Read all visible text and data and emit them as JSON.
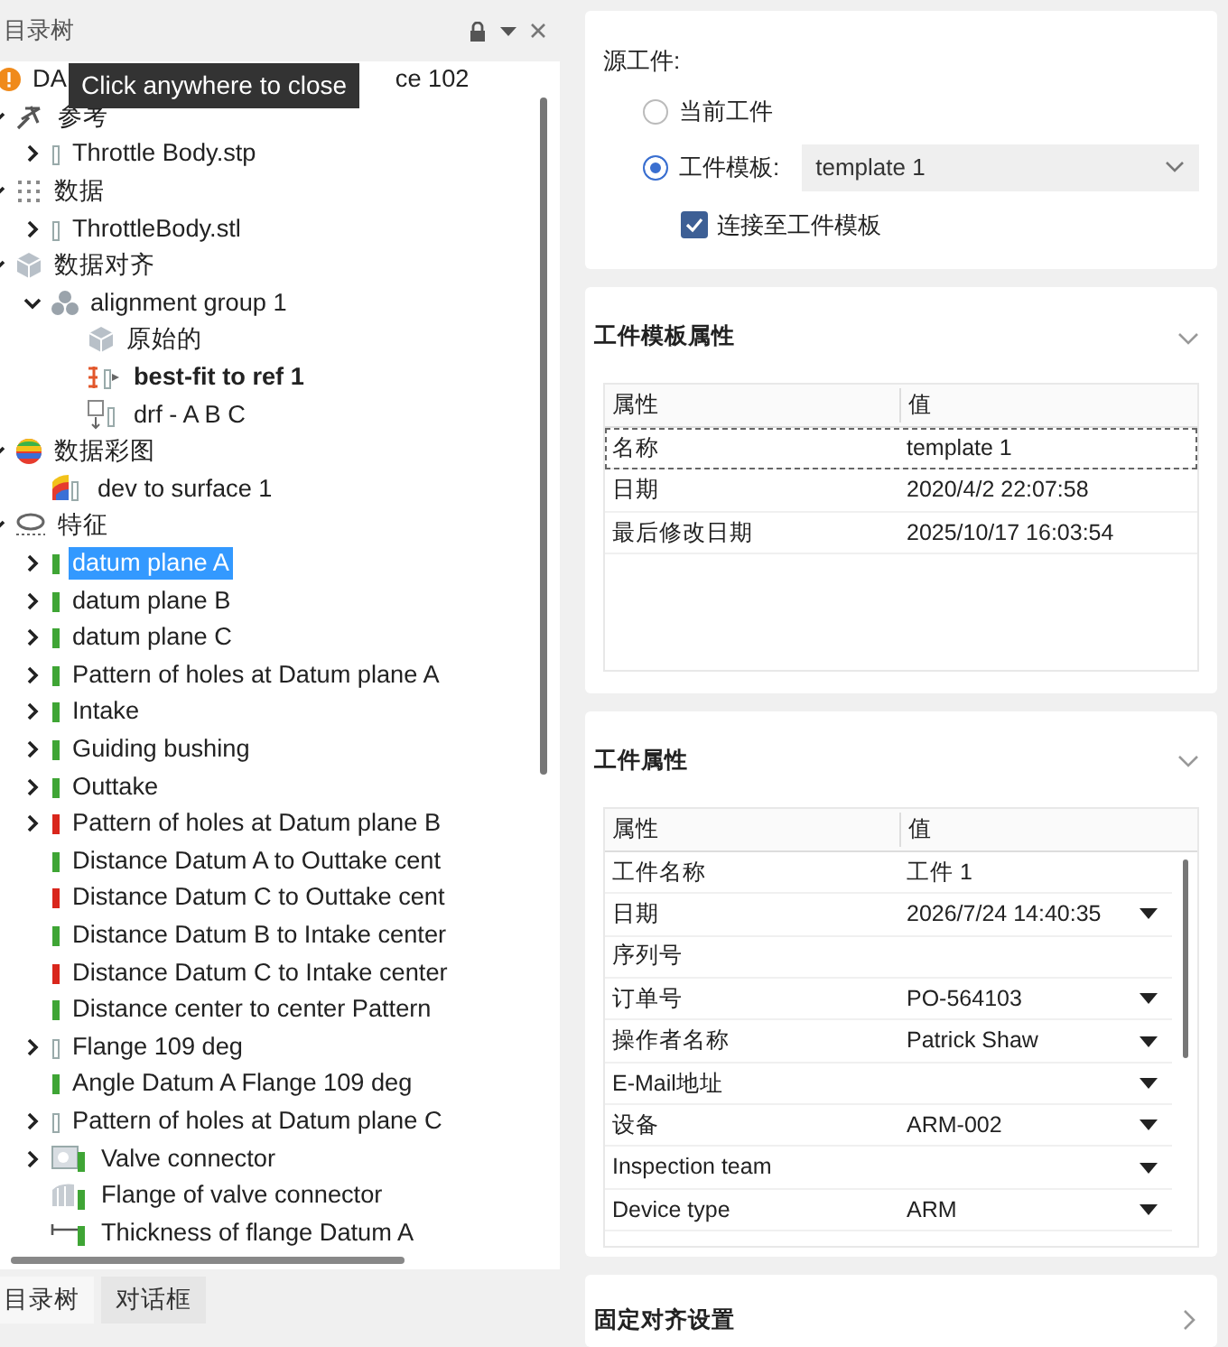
{
  "tree_panel": {
    "title": "目录树",
    "tooltip": "Click anywhere to close",
    "items": [
      {
        "kind": "root",
        "label_parts": [
          "DA",
          "ce 102"
        ],
        "selected": false
      },
      {
        "kind": "reference",
        "label": "参考",
        "expanded": true,
        "selected": false,
        "children": [
          {
            "kind": "blank",
            "label": "Throttle Body.stp",
            "expanded": false,
            "selected": false
          }
        ]
      },
      {
        "kind": "data",
        "label": "数据",
        "expanded": true,
        "selected": false,
        "children": [
          {
            "kind": "mesh",
            "label": "ThrottleBody.stl",
            "expanded": false,
            "selected": false
          }
        ]
      },
      {
        "kind": "alignment",
        "label": "数据对齐",
        "expanded": true,
        "selected": false,
        "children": [
          {
            "kind": "group",
            "label": "alignment group 1",
            "expanded": true,
            "selected": false,
            "children": [
              {
                "kind": "cube",
                "label": "原始的",
                "active": false,
                "selected": false
              },
              {
                "kind": "bestfit",
                "label": "best-fit to ref 1",
                "active": true,
                "selected": false
              },
              {
                "kind": "drf",
                "label": "drf - A B C",
                "active": false,
                "selected": false
              }
            ]
          }
        ]
      },
      {
        "kind": "colormap",
        "label": "数据彩图",
        "expanded": true,
        "selected": false,
        "children": [
          {
            "kind": "devmap",
            "label": "dev to surface 1",
            "selected": false
          }
        ]
      },
      {
        "kind": "features",
        "label": "特征",
        "expanded": true,
        "selected": false,
        "children": [
          {
            "kind": "feature",
            "label": "datum plane A",
            "color": "#3fa535",
            "expanded": false,
            "selected": true
          },
          {
            "kind": "feature",
            "label": "datum plane B",
            "color": "#3fa535",
            "expanded": false,
            "selected": false
          },
          {
            "kind": "feature",
            "label": "datum plane C",
            "color": "#3fa535",
            "expanded": false,
            "selected": false
          },
          {
            "kind": "feature",
            "label": "Pattern of holes at Datum plane A",
            "color": "#3fa535",
            "expanded": false,
            "selected": false
          },
          {
            "kind": "feature",
            "label": "Intake",
            "color": "#3fa535",
            "expanded": false,
            "selected": false
          },
          {
            "kind": "feature",
            "label": "Guiding bushing",
            "color": "#3fa535",
            "expanded": false,
            "selected": false
          },
          {
            "kind": "feature",
            "label": "Outtake",
            "color": "#3fa535",
            "expanded": false,
            "selected": false
          },
          {
            "kind": "feature",
            "label": "Pattern of holes at Datum plane B",
            "color": "#d9261c",
            "expanded": false,
            "selected": false
          },
          {
            "kind": "feature",
            "label": "Distance Datum A to Outtake cent",
            "color": "#3fa535",
            "selected": false
          },
          {
            "kind": "feature",
            "label": "Distance Datum C to Outtake cent",
            "color": "#d9261c",
            "selected": false
          },
          {
            "kind": "feature",
            "label": "Distance Datum B to Intake center",
            "color": "#3fa535",
            "selected": false
          },
          {
            "kind": "feature",
            "label": "Distance Datum C to Intake center",
            "color": "#d9261c",
            "selected": false
          },
          {
            "kind": "feature",
            "label": "Distance center to center Pattern",
            "color": "#3fa535",
            "selected": false
          },
          {
            "kind": "feature-empty",
            "label": "Flange 109 deg",
            "expanded": false,
            "selected": false
          },
          {
            "kind": "feature",
            "label": "Angle Datum A Flange 109 deg",
            "color": "#3fa535",
            "selected": false
          },
          {
            "kind": "feature-empty",
            "label": "Pattern of holes at Datum plane C",
            "expanded": false,
            "selected": false
          },
          {
            "kind": "valve",
            "label": "Valve connector",
            "color": "#3fa535",
            "expanded": false,
            "selected": false
          },
          {
            "kind": "flange",
            "label": "Flange of valve connector",
            "color": "#3fa535",
            "selected": false
          },
          {
            "kind": "thickness",
            "label": "Thickness of flange Datum A",
            "color": "#3fa535",
            "selected": false
          }
        ]
      }
    ],
    "bottom_tabs": [
      {
        "label": "目录树",
        "selected": true
      },
      {
        "label": "对话框",
        "selected": false
      }
    ]
  },
  "source_card": {
    "label": "源工件:",
    "options": [
      {
        "label": "当前工件",
        "selected": false
      },
      {
        "label": "工件模板:",
        "selected": true,
        "value": "template 1"
      }
    ],
    "link_checkbox": {
      "label": "连接至工件模板",
      "checked": true
    }
  },
  "template_card": {
    "title": "工件模板属性",
    "expanded": true,
    "columns": [
      "属性",
      "值"
    ],
    "rows": [
      {
        "name": "名称",
        "value": "template 1",
        "selected": true
      },
      {
        "name": "日期",
        "value": "2020/4/2 22:07:58",
        "selected": false
      },
      {
        "name": "最后修改日期",
        "value": "2025/10/17 16:03:54",
        "selected": false
      }
    ]
  },
  "part_card": {
    "title": "工件属性",
    "expanded": true,
    "columns": [
      "属性",
      "值"
    ],
    "rows": [
      {
        "name": "工件名称",
        "value": "工件 1",
        "dropdown": false
      },
      {
        "name": "日期",
        "value": "2026/7/24 14:40:35",
        "dropdown": true
      },
      {
        "name": "序列号",
        "dropdown": false
      },
      {
        "name": "订单号",
        "value": "PO-564103",
        "dropdown": true
      },
      {
        "name": "操作者名称",
        "value": "Patrick Shaw",
        "dropdown": true
      },
      {
        "name": "E-Mail地址",
        "dropdown": true
      },
      {
        "name": "设备",
        "value": "ARM-002",
        "dropdown": true
      },
      {
        "name": "Inspection team",
        "dropdown": true
      },
      {
        "name": "Device type",
        "value": "ARM",
        "dropdown": true
      }
    ]
  },
  "align_card": {
    "title": "固定对齐设置",
    "expanded": false
  }
}
